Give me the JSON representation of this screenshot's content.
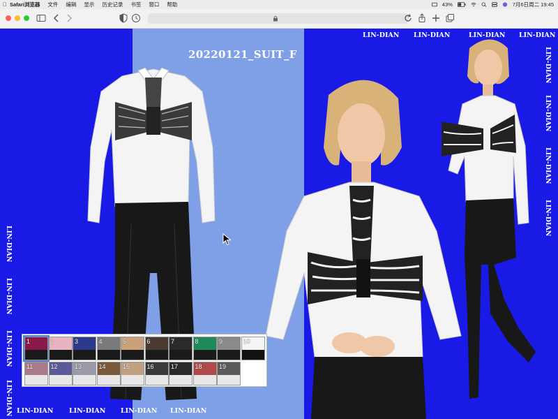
{
  "menubar": {
    "app": "Safari浏览器",
    "items": [
      "文件",
      "编辑",
      "显示",
      "历史记录",
      "书签",
      "窗口",
      "帮助"
    ],
    "battery": "43%",
    "datetime": "7月6日周二 19:45"
  },
  "page": {
    "title": "20220121_SUIT_F",
    "watermark": "LIN-DIAN"
  },
  "swatches": [
    {
      "num": "1",
      "top": "#8a1848",
      "bottom": "#1a1a1a",
      "selected": true
    },
    {
      "num": "2",
      "top": "#e8b4c0",
      "bottom": "#1a1a1a"
    },
    {
      "num": "3",
      "top": "#2b3a8a",
      "bottom": "#1a1a1a"
    },
    {
      "num": "4",
      "top": "#7a7a7a",
      "bottom": "#1a1a1a"
    },
    {
      "num": "5",
      "top": "#c9a07a",
      "bottom": "#1a1a1a"
    },
    {
      "num": "6",
      "top": "#4a3a30",
      "bottom": "#1a1a1a"
    },
    {
      "num": "7",
      "top": "#2a2a2a",
      "bottom": "#1a1a1a"
    },
    {
      "num": "8",
      "top": "#1f8a5a",
      "bottom": "#1a1a1a"
    },
    {
      "num": "9",
      "top": "#8a8a8a",
      "bottom": "#1a1a1a"
    },
    {
      "num": "10",
      "top": "#f4f4f4",
      "bottom": "#111111"
    },
    {
      "num": "11",
      "top": "#a87a8a",
      "bottom": "#e8e8e8"
    },
    {
      "num": "12",
      "top": "#5a5a9a",
      "bottom": "#e8e8e8"
    },
    {
      "num": "13",
      "top": "#9a9aaa",
      "bottom": "#e8e8e8"
    },
    {
      "num": "14",
      "top": "#7a5a3a",
      "bottom": "#e8e8e8"
    },
    {
      "num": "15",
      "top": "#c0a080",
      "bottom": "#e8e8e8"
    },
    {
      "num": "16",
      "top": "#3a3a3a",
      "bottom": "#e8e8e8"
    },
    {
      "num": "17",
      "top": "#2a2a2a",
      "bottom": "#e8e8e8"
    },
    {
      "num": "18",
      "top": "#b04a4a",
      "bottom": "#e8e8e8"
    },
    {
      "num": "19",
      "top": "#5a5a5a",
      "bottom": "#e8e8e8"
    }
  ],
  "colors": {
    "bg_blue": "#1a1ae6",
    "bg_light_blue": "#7f9fe6"
  }
}
